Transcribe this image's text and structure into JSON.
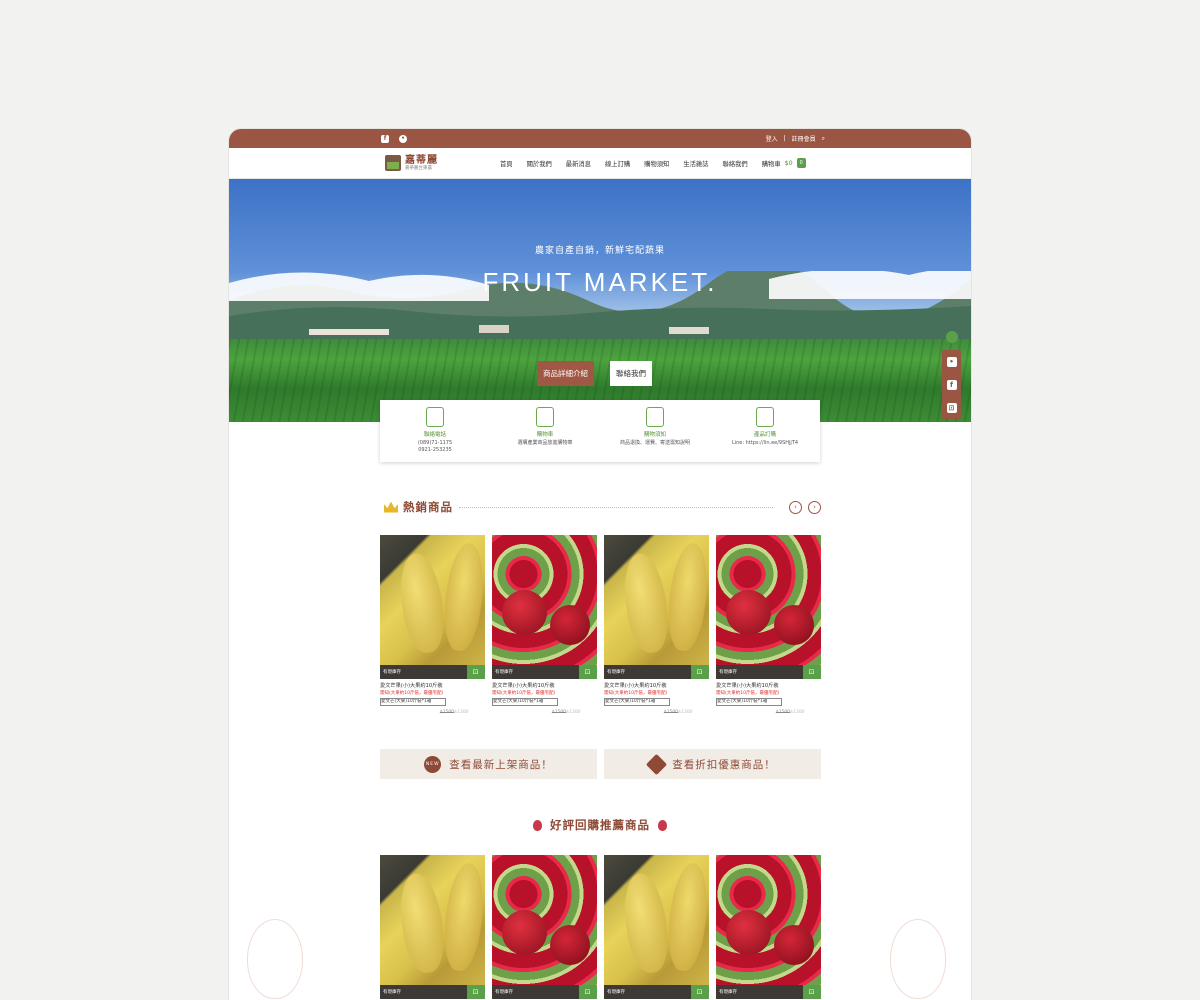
{
  "topbar": {
    "facebook_icon": "facebook-icon",
    "line_icon": "line-icon",
    "login": "登入",
    "register": "註冊會員",
    "search_icon": "search-icon"
  },
  "header": {
    "logo_title": "嘉蒂麗",
    "logo_subtitle": "嘉蒂麗台東農",
    "menu": [
      "首頁",
      "關於我們",
      "最新消息",
      "線上訂購",
      "購物須知",
      "生活雜誌",
      "聯絡我們"
    ],
    "cart_label": "購物車",
    "cart_amount": "$0",
    "cart_count": "0"
  },
  "hero": {
    "subtitle": "農家自產自銷，新鮮宅配蔬果",
    "title": "FRUIT MARKET.",
    "primary_button": "商品詳細介紹",
    "secondary_button": "聯絡我們"
  },
  "info": [
    {
      "label": "聯絡電話",
      "text": "(089)71-1175\n0921-253235",
      "icon": "phone-icon"
    },
    {
      "label": "購物車",
      "text": "選購產業商品放進購物車",
      "icon": "cart-icon"
    },
    {
      "label": "購物須知",
      "text": "商品退換、運費、寄送需知說明",
      "icon": "notice-icon"
    },
    {
      "label": "產品訂購",
      "text": "Line: https://lin.ee/9SHjjT4",
      "icon": "order-icon"
    }
  ],
  "hot_section": {
    "title": "熱銷商品"
  },
  "products": [
    {
      "type": "mango",
      "stock": "有現庫存",
      "name": "愛文芒果(小)大果約10斤裝",
      "note": "需知(大果約10斤裝，最優宅配)",
      "option": "愛文芒(大果)10斤裝*1箱",
      "old_price": "$1500",
      "price": "$1300"
    },
    {
      "type": "apple",
      "stock": "有現庫存",
      "name": "愛文芒果(小)大果約10斤裝",
      "note": "需知(大果約10斤裝，最優宅配)",
      "option": "愛文芒(大果)10斤裝*1箱",
      "old_price": "$1500",
      "price": "$1300"
    },
    {
      "type": "mango",
      "stock": "有現庫存",
      "name": "愛文芒果(小)大果約10斤裝",
      "note": "需知(大果約10斤裝，最優宅配)",
      "option": "愛文芒(大果)10斤裝*1箱",
      "old_price": "$1500",
      "price": "$1300"
    },
    {
      "type": "apple",
      "stock": "有現庫存",
      "name": "愛文芒果(小)大果約10斤裝",
      "note": "需知(大果約10斤裝，最優宅配)",
      "option": "愛文芒(大果)10斤裝*1箱",
      "old_price": "$1500",
      "price": "$1300"
    }
  ],
  "cta": {
    "new_badge": "NEW",
    "new_label": "查看最新上架商品！",
    "sale_label": "查看折扣優惠商品！"
  },
  "recommend_section": {
    "title": "好評回購推薦商品"
  },
  "recommend_products": [
    {
      "type": "mango",
      "stock": "有現庫存"
    },
    {
      "type": "apple",
      "stock": "有現庫存"
    },
    {
      "type": "mango",
      "stock": "有現庫存"
    },
    {
      "type": "apple",
      "stock": "有現庫存"
    }
  ],
  "colors": {
    "brand": "#9a5543",
    "accent_green": "#5aa04b",
    "text_brown": "#8e4a36"
  }
}
